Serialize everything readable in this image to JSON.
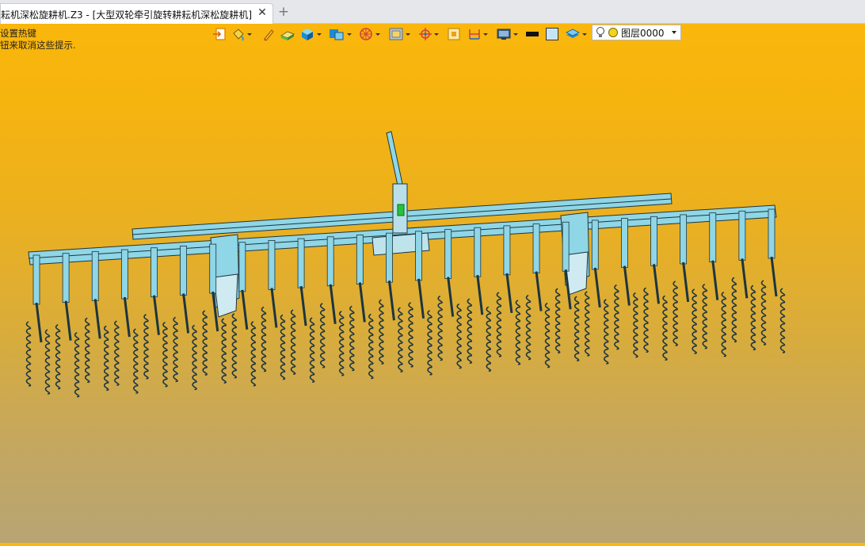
{
  "tab": {
    "title": "耘机深松旋耕机.Z3 - [大型双轮牵引旋转耕耘机深松旋耕机]",
    "close_glyph": "✕",
    "new_tab_glyph": "+"
  },
  "hint": {
    "line1": "设置热键",
    "line2": "钮来取消这些提示."
  },
  "toolbar": {
    "icons": [
      {
        "name": "import-icon",
        "dropdown": false
      },
      {
        "name": "paint-bucket-icon",
        "dropdown": true
      },
      {
        "name": "pen-icon",
        "dropdown": false
      },
      {
        "name": "sketch-block-icon",
        "dropdown": false
      },
      {
        "name": "solid-box-icon",
        "dropdown": true
      },
      {
        "name": "shape-box-icon",
        "dropdown": true
      },
      {
        "name": "wheel-icon",
        "dropdown": true
      },
      {
        "name": "view-frame-icon",
        "dropdown": true
      },
      {
        "name": "target-icon",
        "dropdown": true
      },
      {
        "name": "select-box-icon",
        "dropdown": false
      },
      {
        "name": "dimension-icon",
        "dropdown": true
      },
      {
        "name": "display-settings-icon",
        "dropdown": true
      },
      {
        "name": "line-color-swatch",
        "dropdown": false
      },
      {
        "name": "fill-color-swatch",
        "dropdown": false
      },
      {
        "name": "layer-stack-icon",
        "dropdown": true
      }
    ],
    "layer": {
      "value": "图层0000",
      "bulb_icon": "bulb-icon",
      "color_icon": "layer-color-icon"
    },
    "colors": {
      "line_color": "#111111",
      "fill_color": "#c6e4f5"
    }
  },
  "viewport": {
    "model_color": "#8fd6e6",
    "outline_color": "#1c3540",
    "highlight": "#22c53a"
  }
}
